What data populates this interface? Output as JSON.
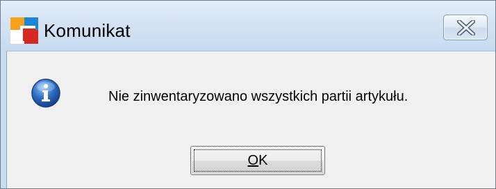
{
  "window": {
    "title": "Komunikat",
    "icon": "app-logo-icon",
    "close_icon": "close-icon"
  },
  "message": {
    "icon": "info-icon",
    "text": "Nie zinwentaryzowano wszystkich partii artykułu."
  },
  "buttons": {
    "ok_mnemonic": "O",
    "ok_rest": "K"
  },
  "colors": {
    "titlebar": "#d3e3f4",
    "client": "#f0f0f0",
    "info_icon": "#2d6fc3"
  }
}
